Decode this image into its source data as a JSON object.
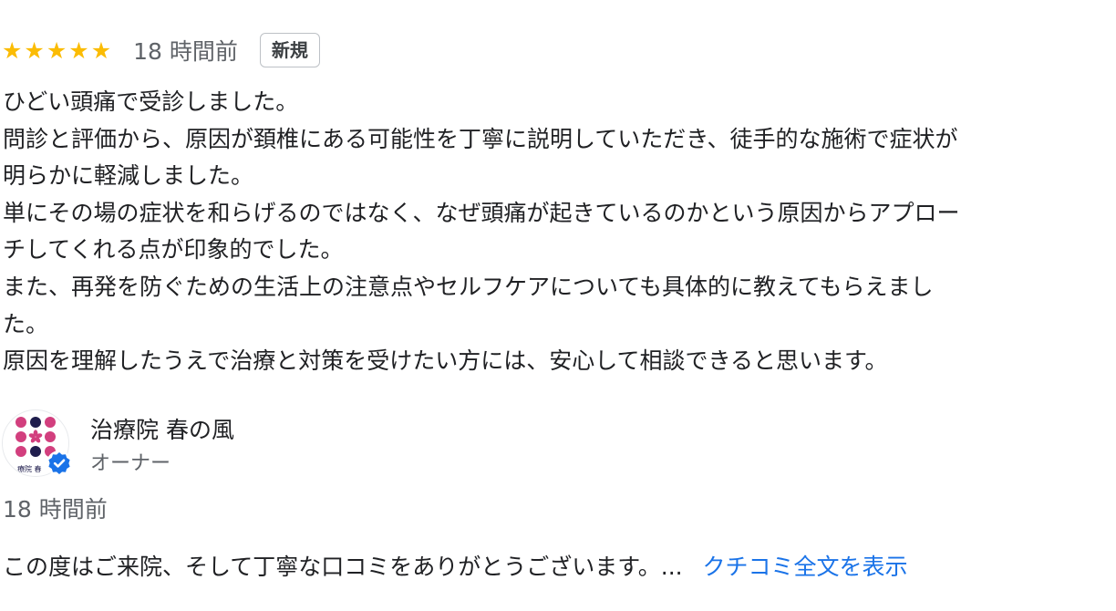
{
  "review": {
    "rating": 5,
    "stars": [
      "★",
      "★",
      "★",
      "★",
      "★"
    ],
    "time_ago": "18 時間前",
    "badge": "新規",
    "text_lines": [
      "ひどい頭痛で受診しました。",
      "問診と評価から、原因が頚椎にある可能性を丁寧に説明していただき、徒手的な施術で症状が",
      "明らかに軽減しました。",
      "単にその場の症状を和らげるのではなく、なぜ頭痛が起きているのかという原因からアプロー",
      "チしてくれる点が印象的でした。",
      "また、再発を防ぐための生活上の注意点やセルフケアについても具体的に教えてもらえまし",
      "た。",
      "原因を理解したうえで治療と対策を受けたい方には、安心して相談できると思います。"
    ],
    "star_color": "#fbbc04"
  },
  "owner_reply": {
    "owner_name": "治療院 春の風",
    "owner_role": "オーナー",
    "time_ago": "18 時間前",
    "reply_preview": "この度はご来院、そして丁寧な口コミをありがとうございます。...",
    "read_more_label": "クチコミ全文を表示",
    "avatar_logo_text": "療院 春",
    "avatar_icon": "clinic-logo-icon",
    "verified_icon": "verified-badge-icon",
    "link_color": "#1a73e8",
    "verified_color": "#1a73e8"
  }
}
